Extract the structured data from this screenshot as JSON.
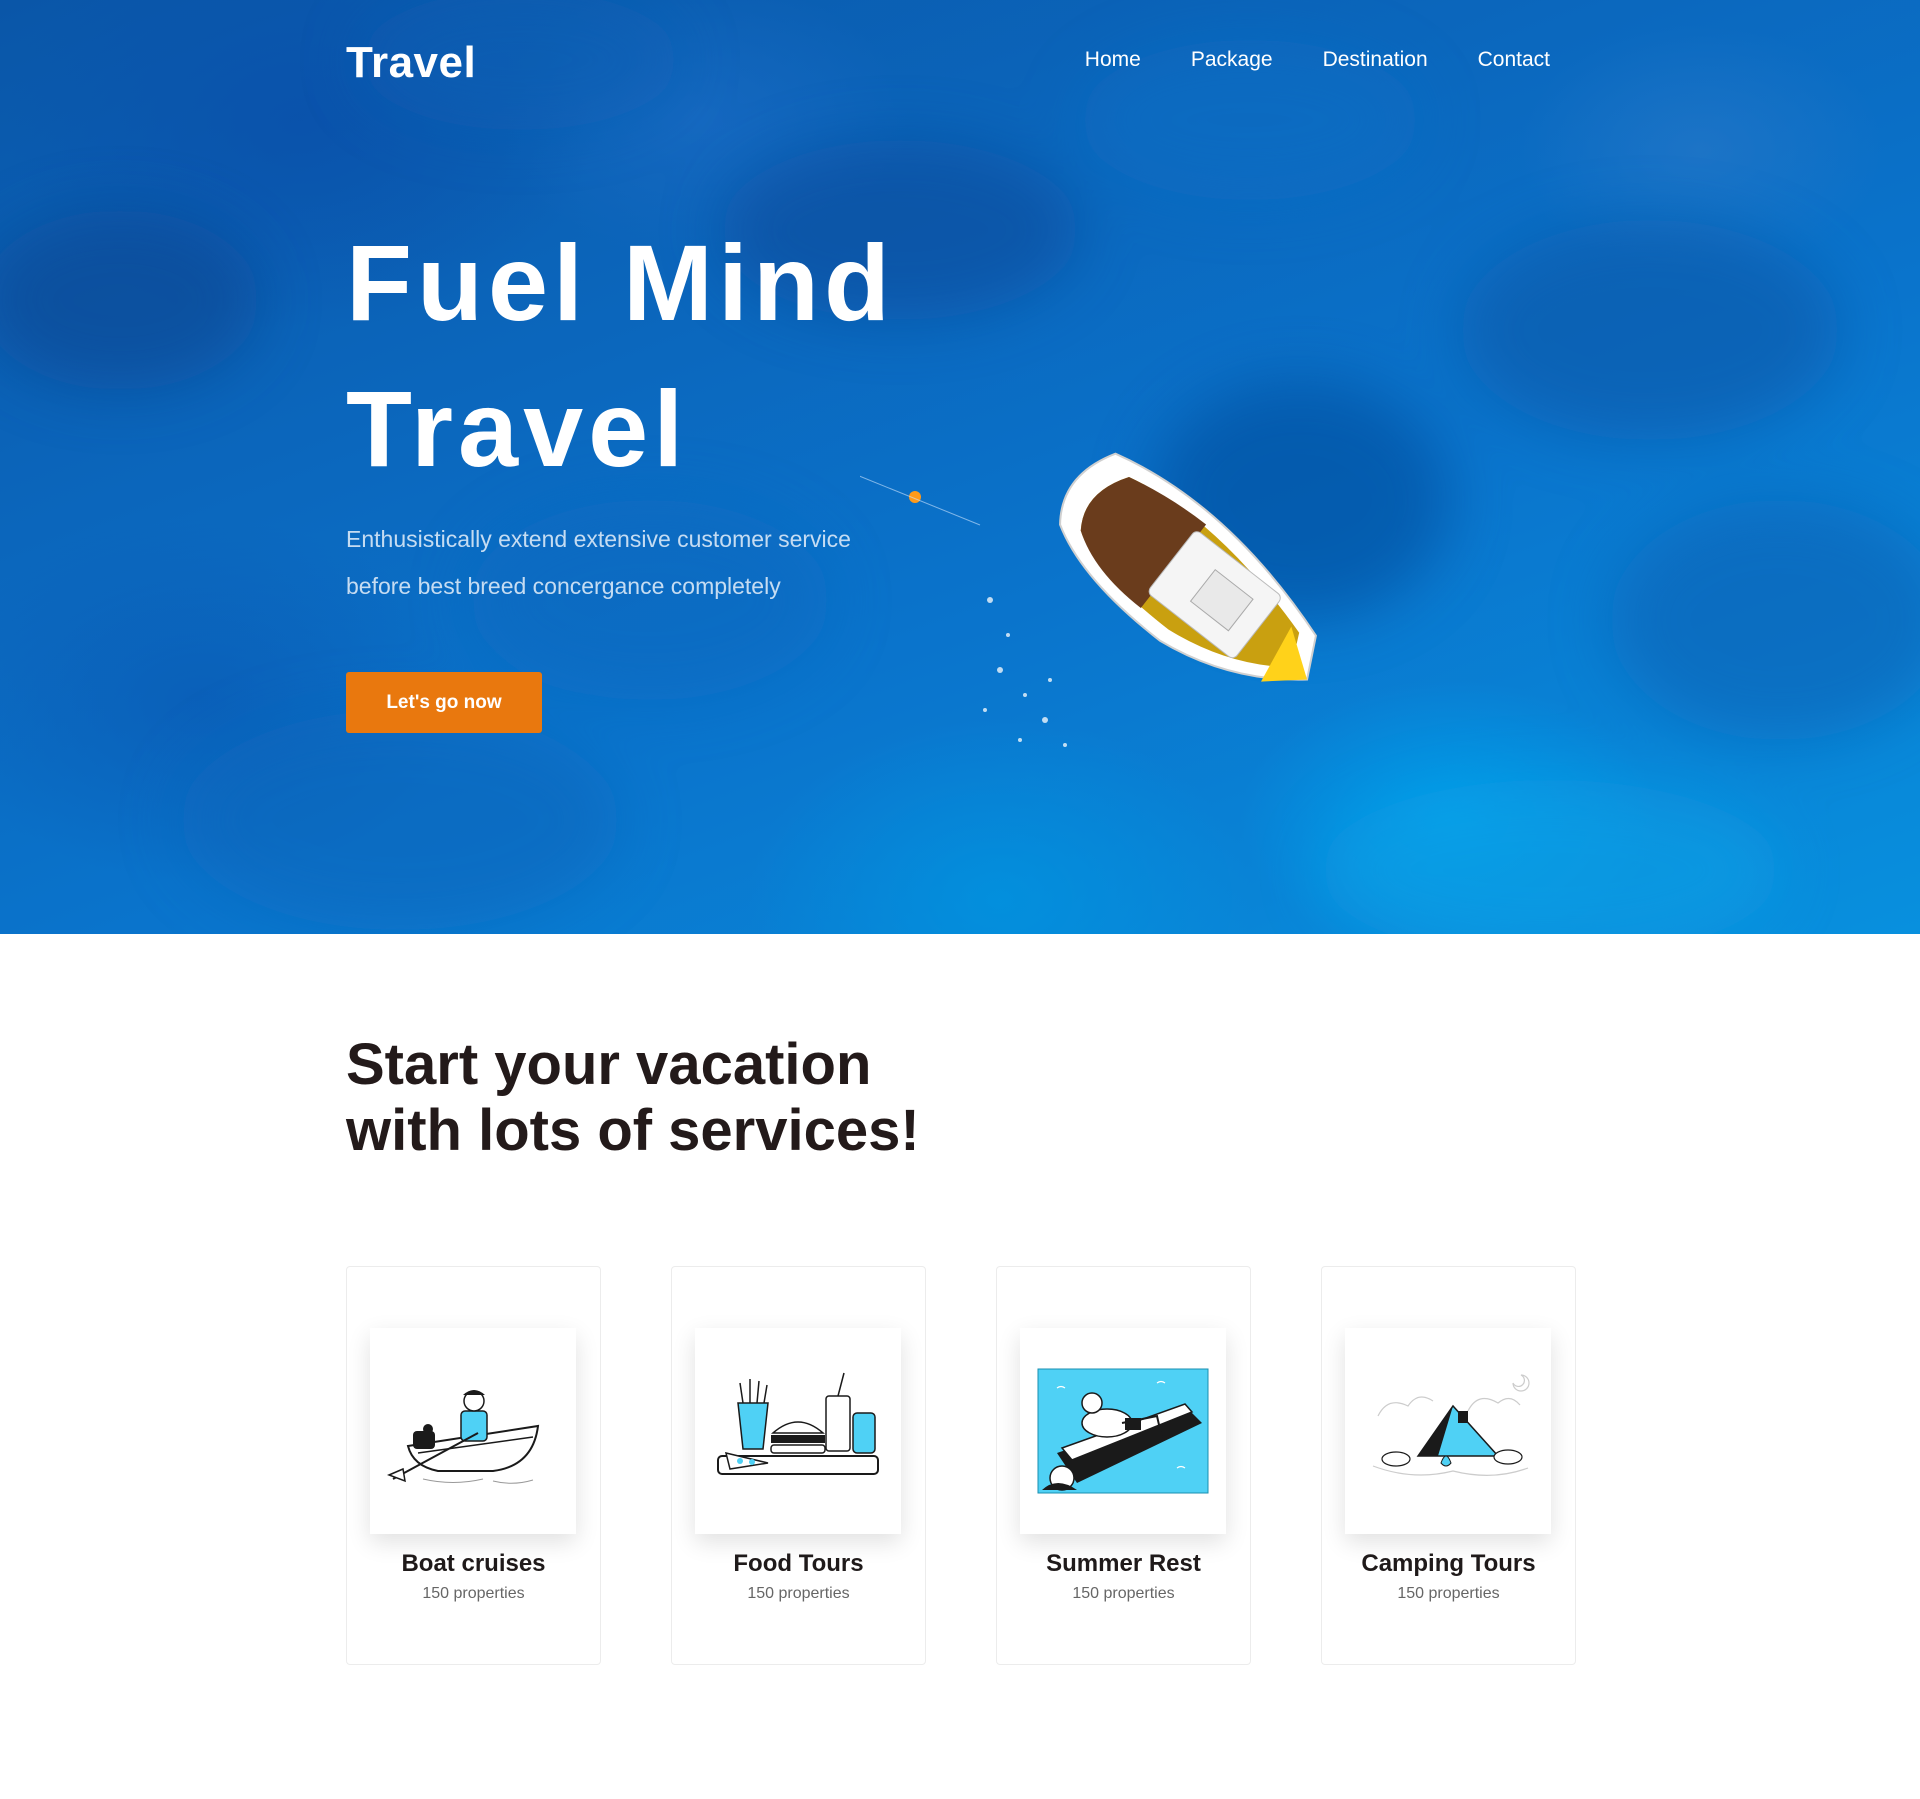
{
  "nav": {
    "logo": "Travel",
    "links": [
      "Home",
      "Package",
      "Destination",
      "Contact"
    ]
  },
  "hero": {
    "headline_line1": "Fuel Mind",
    "headline_line2": "Travel",
    "subtext_line1": "Enthusistically extend extensive customer service",
    "subtext_line2": "before best breed concergance completely",
    "cta_label": "Let's go now"
  },
  "services": {
    "title_line1": "Start your vacation",
    "title_line2": "with lots of services!",
    "cards": [
      {
        "title": "Boat cruises",
        "subtitle": "150 properties",
        "icon": "boat-illustration-icon"
      },
      {
        "title": "Food Tours",
        "subtitle": "150 properties",
        "icon": "food-illustration-icon"
      },
      {
        "title": "Summer Rest",
        "subtitle": "150 properties",
        "icon": "summer-illustration-icon"
      },
      {
        "title": "Camping Tours",
        "subtitle": "150 properties",
        "icon": "camping-illustration-icon"
      }
    ]
  },
  "colors": {
    "accent": "#e9780e",
    "hero_blue": "#0b67bd",
    "illustration_blue": "#4fd1f5",
    "heading": "#231a1a"
  }
}
